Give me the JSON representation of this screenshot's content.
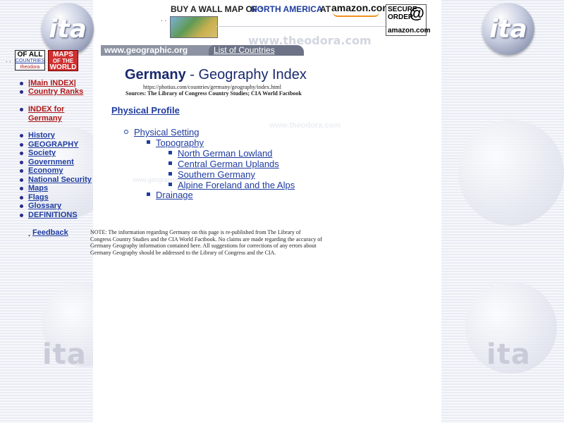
{
  "header": {
    "buy_label": "BUY A WALL MAP OF :",
    "region_link": "NORTH AMERICA",
    "at_label": "AT",
    "amazon_text": "amazon.com",
    "secure_lines": [
      "SECURE",
      "ORDER"
    ],
    "secure_at": "@",
    "secure_amazon": "amazon.com",
    "dots": ". .",
    "watermark_right": "www.theodora.com"
  },
  "badges": {
    "all_line1": "OF ALL",
    "all_line2": "COUNTRIES",
    "all_line3": "theodora",
    "maps_line1": "MAPS",
    "maps_line2": "OF THE",
    "maps_line3": "WORLD",
    "dots": ". ."
  },
  "logos": {
    "left": "ita",
    "right": "ita"
  },
  "navbar": {
    "site": "www.geographic.org",
    "list": "List of Countries"
  },
  "sidebar": {
    "top_links": [
      {
        "label": "|Main INDEX|",
        "color": "#b01818"
      },
      {
        "label": "Country Ranks",
        "color": "#b01818"
      }
    ],
    "index_label_1": "INDEX for",
    "index_label_2": "Germany",
    "sections": [
      "History",
      "GEOGRAPHY",
      "Society",
      "Government",
      "Economy",
      "National Security",
      "Maps",
      "Flags",
      "Glossary",
      "DEFINITIONS"
    ],
    "feedback_prefix": ".",
    "feedback": "Feedback"
  },
  "main": {
    "title_bold": "Germany",
    "title_rest": " - Geography Index",
    "url": "https://photius.com/countries/germany/geography/index.html",
    "sources": "Sources: The Library of Congress Country Studies; CIA World Factbook",
    "section": "Physical Profile",
    "tree": {
      "level1": "Physical Setting",
      "level2a": "Topography",
      "level3": [
        "North German Lowland",
        "Central German Uplands",
        "Southern Germany",
        "Alpine Foreland and the Alps"
      ],
      "level2b": "Drainage"
    },
    "note": "NOTE: The information regarding Germany on this page is re-published from The Library of Congress Country Studies and the CIA World Factbook. No claims are made regarding the accuracy of Germany Geography information contained here. All suggestions for corrections of any errors about Germany Geography should be addressed to the Library of Congress and the CIA.",
    "watermark": "www.theodora.com",
    "watermark2": "www.geographic.org"
  },
  "colors": {
    "link_blue": "#1f3ca0",
    "link_red": "#b01818",
    "title_navy": "#1a2a6e",
    "nav_gray": "#8d93a2"
  }
}
